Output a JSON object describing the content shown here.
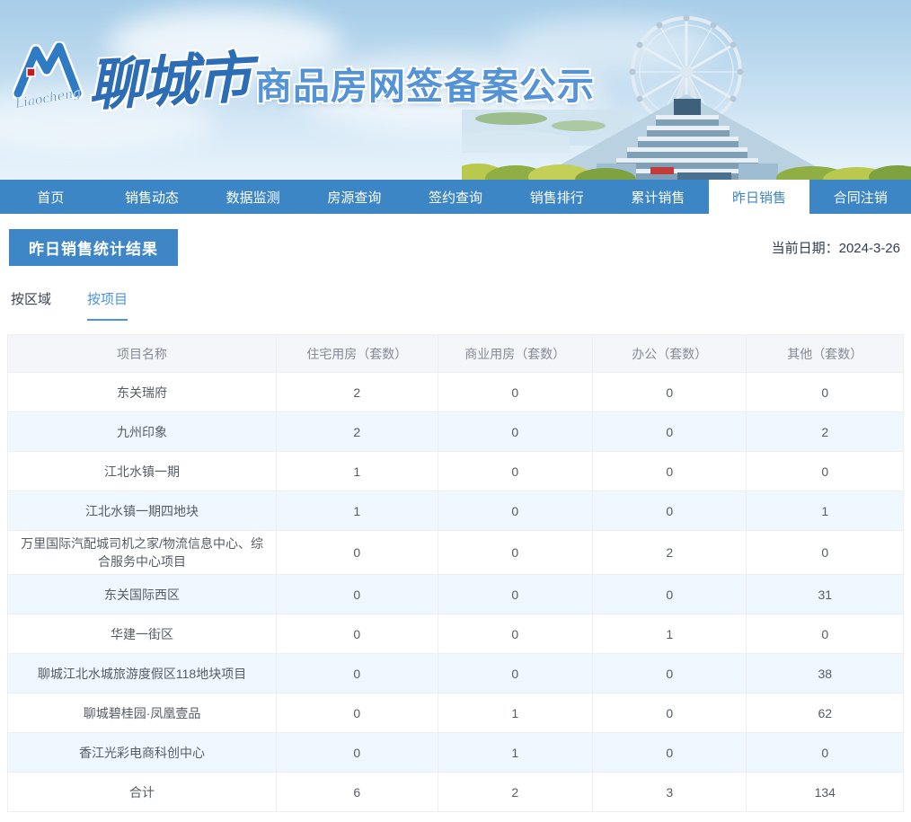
{
  "header": {
    "logo_script": "Liaocheng",
    "brand": "聊城市",
    "site_title": "商品房网签备案公示"
  },
  "nav": {
    "items": [
      {
        "label": "首页",
        "active": false
      },
      {
        "label": "销售动态",
        "active": false
      },
      {
        "label": "数据监测",
        "active": false
      },
      {
        "label": "房源查询",
        "active": false
      },
      {
        "label": "签约查询",
        "active": false
      },
      {
        "label": "销售排行",
        "active": false
      },
      {
        "label": "累计销售",
        "active": false
      },
      {
        "label": "昨日销售",
        "active": true
      },
      {
        "label": "合同注销",
        "active": false
      }
    ]
  },
  "page": {
    "title": "昨日销售统计结果",
    "date_text": "当前日期：2024-3-26"
  },
  "subtabs": [
    {
      "label": "按区域",
      "active": false
    },
    {
      "label": "按项目",
      "active": true
    }
  ],
  "table": {
    "columns": [
      "项目名称",
      "住宅用房（套数）",
      "商业用房（套数）",
      "办公（套数）",
      "其他（套数）"
    ],
    "rows": [
      [
        "东关瑞府",
        "2",
        "0",
        "0",
        "0"
      ],
      [
        "九州印象",
        "2",
        "0",
        "0",
        "2"
      ],
      [
        "江北水镇一期",
        "1",
        "0",
        "0",
        "0"
      ],
      [
        "江北水镇一期四地块",
        "1",
        "0",
        "0",
        "1"
      ],
      [
        "万里国际汽配城司机之家/物流信息中心、综合服务中心项目",
        "0",
        "0",
        "2",
        "0"
      ],
      [
        "东关国际西区",
        "0",
        "0",
        "0",
        "31"
      ],
      [
        "华建一街区",
        "0",
        "0",
        "1",
        "0"
      ],
      [
        "聊城江北水城旅游度假区118地块项目",
        "0",
        "0",
        "0",
        "38"
      ],
      [
        "聊城碧桂园·凤凰壹品",
        "0",
        "1",
        "0",
        "62"
      ],
      [
        "香江光彩电商科创中心",
        "0",
        "1",
        "0",
        "0"
      ],
      [
        "合计",
        "6",
        "2",
        "3",
        "134"
      ]
    ]
  },
  "colors": {
    "nav_blue": "#3d86c5",
    "title_box_blue": "#3e86c6",
    "active_subtab_blue": "#4a94da",
    "row_alt_blue": "#eff8fe",
    "table_header_bg": "#f5f6fa"
  }
}
